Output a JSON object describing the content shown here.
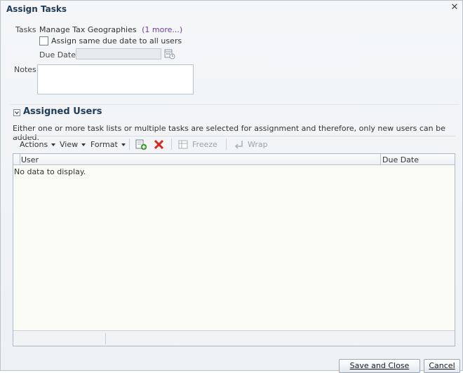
{
  "dialog": {
    "title": "Assign Tasks",
    "close_glyph": "✕"
  },
  "form": {
    "tasks_label": "Tasks",
    "tasks_value": "Manage Tax Geographies",
    "tasks_more": "(1 more...)",
    "same_due_date_label": "Assign same due date to all users",
    "same_due_date_checked": false,
    "due_date_label": "Due Date",
    "due_date_value": "",
    "notes_label": "Notes",
    "notes_value": ""
  },
  "section": {
    "title": "Assigned Users",
    "expanded": true,
    "info_text": "Either one or more task lists or multiple tasks are selected for assignment and therefore, only new users can be added."
  },
  "toolbar": {
    "actions": "Actions",
    "view": "View",
    "format": "Format",
    "add_icon": "add-icon",
    "delete_icon": "delete-icon",
    "freeze": "Freeze",
    "wrap": "Wrap"
  },
  "table": {
    "columns": [
      "User",
      "Due Date"
    ],
    "empty_text": "No data to display."
  },
  "buttons": {
    "save_close": "Save and Close",
    "cancel": "Cancel"
  },
  "colors": {
    "title": "#1f3b59",
    "link": "#6b3d9a",
    "delete": "#d9261c",
    "add": "#3c9a2f"
  }
}
